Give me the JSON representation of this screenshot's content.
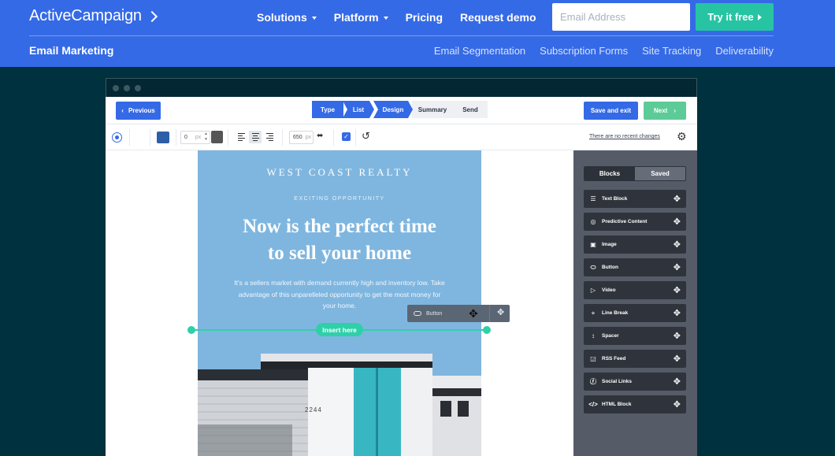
{
  "site": {
    "logo": "ActiveCampaign",
    "nav": [
      {
        "label": "Solutions",
        "caret": true
      },
      {
        "label": "Platform",
        "caret": true
      },
      {
        "label": "Pricing",
        "caret": false
      },
      {
        "label": "Request demo",
        "caret": false
      }
    ],
    "email_placeholder": "Email Address",
    "try_label": "Try it free",
    "subtitle": "Email Marketing",
    "subnav": [
      "Email Segmentation",
      "Subscription Forms",
      "Site Tracking",
      "Deliverability"
    ],
    "colors": {
      "brand": "#356ae6",
      "accent": "#27c4a4",
      "background": "#00313e"
    }
  },
  "wizard": {
    "previous_label": "Previous",
    "steps": [
      {
        "label": "Type",
        "active": true
      },
      {
        "label": "List",
        "active": true
      },
      {
        "label": "Design",
        "active": true
      },
      {
        "label": "Summary",
        "active": false
      },
      {
        "label": "Send",
        "active": false
      }
    ],
    "save_label": "Save and exit",
    "next_label": "Next"
  },
  "toolbar": {
    "padding_value": "0",
    "padding_unit": "px",
    "width_value": "650",
    "width_unit": "px",
    "recent_changes": "There are no recent changes"
  },
  "email": {
    "brand": "WEST COAST REALTY",
    "eyebrow": "EXCITING OPPORTUNITY",
    "headline_line1": "Now is the perfect time",
    "headline_line2": "to sell your home",
    "body": "It's a sellers market with demand currently high and inventory low. Take advantage of this unparelleled opportunity to get the most money for your home.",
    "house_number": "2244"
  },
  "drag": {
    "ghost_label": "Button",
    "insert_label": "Insert here"
  },
  "sidebar": {
    "tabs": [
      {
        "label": "Blocks",
        "active": true
      },
      {
        "label": "Saved",
        "active": false
      }
    ],
    "blocks": [
      {
        "label": "Text Block",
        "icon": "text-lines-icon"
      },
      {
        "label": "Predictive Content",
        "icon": "target-icon"
      },
      {
        "label": "Image",
        "icon": "image-icon"
      },
      {
        "label": "Button",
        "icon": "button-pill-icon"
      },
      {
        "label": "Video",
        "icon": "play-icon"
      },
      {
        "label": "Line Break",
        "icon": "line-break-icon"
      },
      {
        "label": "Spacer",
        "icon": "spacer-icon"
      },
      {
        "label": "RSS Feed",
        "icon": "rss-icon"
      },
      {
        "label": "Social Links",
        "icon": "facebook-icon"
      },
      {
        "label": "HTML Block",
        "icon": "code-icon"
      }
    ]
  }
}
